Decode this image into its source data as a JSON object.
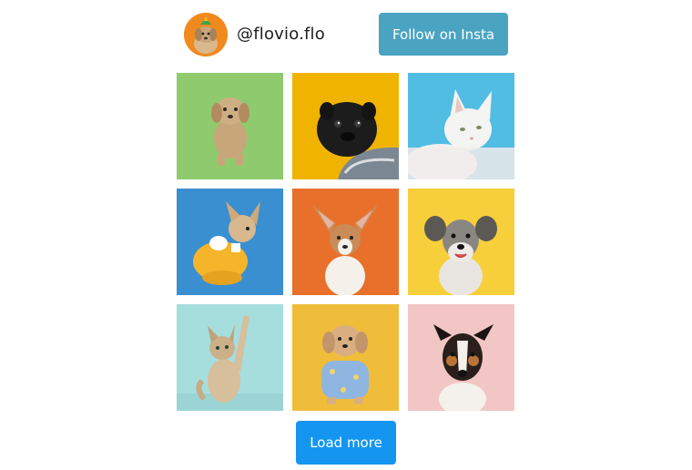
{
  "profile": {
    "username": "@flovio.flo",
    "avatar_icon": "dog-avatar-icon"
  },
  "buttons": {
    "follow_label": "Follow on Insta",
    "load_more_label": "Load more"
  },
  "colors": {
    "follow_button": "#4aa4c1",
    "load_more_button": "#1496f0"
  },
  "photos": [
    {
      "subject": "dog",
      "background": "#8fca6e"
    },
    {
      "subject": "dog",
      "background": "#f0b400"
    },
    {
      "subject": "cat",
      "background": "#52bde3"
    },
    {
      "subject": "dog",
      "background": "#3a8fd0"
    },
    {
      "subject": "dog",
      "background": "#e8702a"
    },
    {
      "subject": "dog",
      "background": "#f7cf3a"
    },
    {
      "subject": "cat",
      "background": "#a6dede"
    },
    {
      "subject": "dog",
      "background": "#f0bd3a"
    },
    {
      "subject": "dog",
      "background": "#f1c6c4"
    }
  ]
}
